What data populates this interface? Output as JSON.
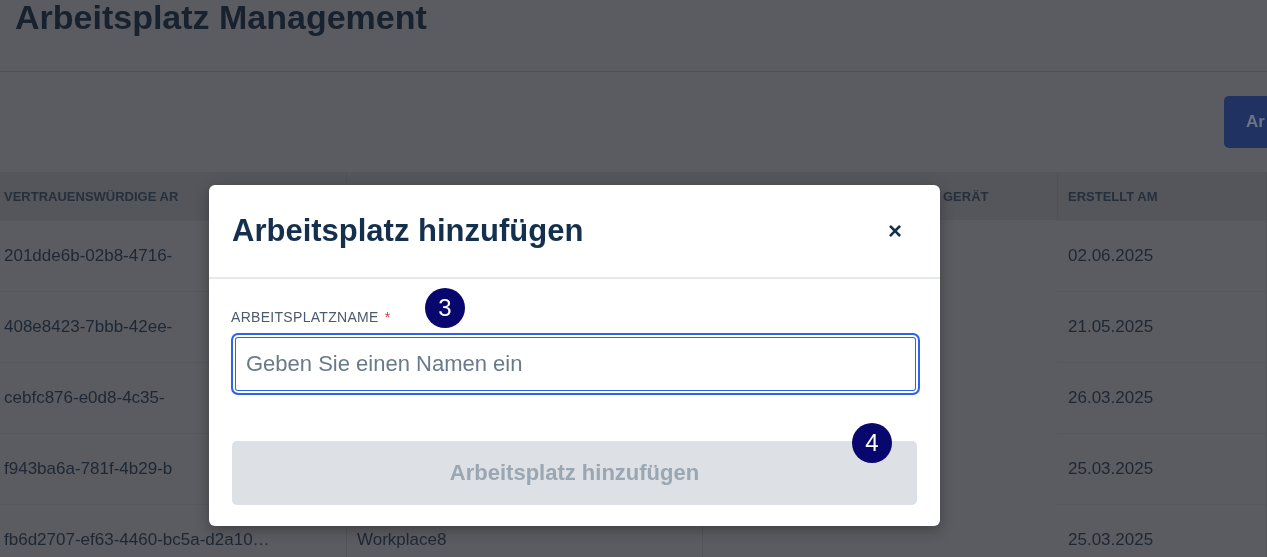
{
  "page": {
    "title": "Arbeitsplatz Management",
    "add_button": "Ar"
  },
  "table": {
    "columns": {
      "column_1": "VERTRAUENSWÜRDIGE AR",
      "column_3": "GERÄT",
      "column_4": "ERSTELLT AM"
    },
    "rows": [
      {
        "column_1": "201dde6b-02b8-4716-",
        "created": "02.06.2025"
      },
      {
        "column_1": "408e8423-7bbb-42ee-",
        "created": "21.05.2025"
      },
      {
        "column_1": "cebfc876-e0d8-4c35-",
        "created": "26.03.2025"
      },
      {
        "column_1": "f943ba6a-781f-4b29-b",
        "created": "25.03.2025"
      },
      {
        "column_1": "fb6d2707-ef63-4460-bc5a-d2a10…",
        "column_2": "Workplace8",
        "created": "25.03.2025"
      }
    ]
  },
  "dialog": {
    "title": "Arbeitsplatz hinzufügen",
    "close": "×",
    "field": {
      "label": "ARBEITSPLATZNAME",
      "required_mark": "*",
      "placeholder": "Geben Sie einen Namen ein",
      "focused": true
    },
    "submit": {
      "label": "Arbeitsplatz hinzufügen",
      "disabled": true
    }
  },
  "annotations": [
    {
      "label": "3"
    },
    {
      "label": "4"
    }
  ]
}
